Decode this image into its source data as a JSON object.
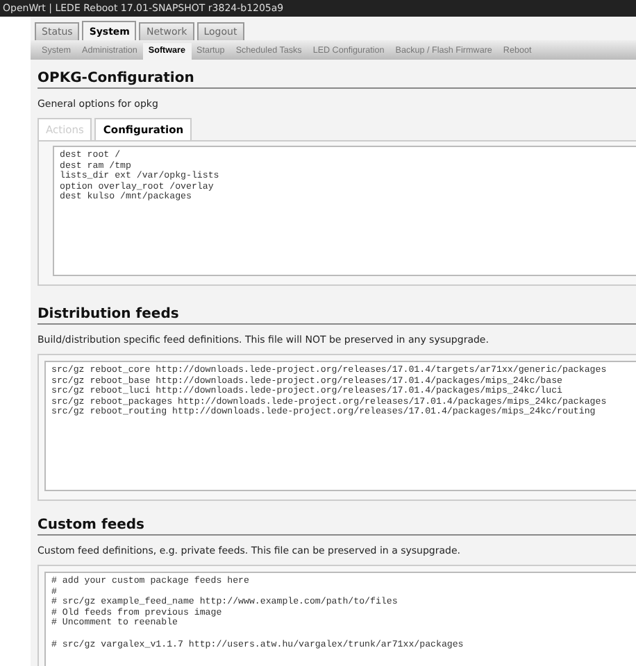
{
  "header": {
    "title": "OpenWrt | LEDE Reboot 17.01-SNAPSHOT r3824-b1205a9"
  },
  "main_tabs": [
    {
      "label": "Status",
      "selected": false
    },
    {
      "label": "System",
      "selected": true
    },
    {
      "label": "Network",
      "selected": false
    },
    {
      "label": "Logout",
      "selected": false
    }
  ],
  "sub_tabs": [
    {
      "label": "System",
      "selected": false
    },
    {
      "label": "Administration",
      "selected": false
    },
    {
      "label": "Software",
      "selected": true
    },
    {
      "label": "Startup",
      "selected": false
    },
    {
      "label": "Scheduled Tasks",
      "selected": false
    },
    {
      "label": "LED Configuration",
      "selected": false
    },
    {
      "label": "Backup / Flash Firmware",
      "selected": false
    },
    {
      "label": "Reboot",
      "selected": false
    }
  ],
  "sections": [
    {
      "title": "OPKG-Configuration",
      "description": "General options for opkg",
      "tabs": [
        {
          "label": "Actions",
          "selected": false,
          "disabled": true
        },
        {
          "label": "Configuration",
          "selected": true,
          "disabled": false
        }
      ],
      "editor": "dest root /\ndest ram /tmp\nlists_dir ext /var/opkg-lists\noption overlay_root /overlay\ndest kulso /mnt/packages"
    },
    {
      "title": "Distribution feeds",
      "description": "Build/distribution specific feed definitions. This file will NOT be preserved in any sysupgrade.",
      "editor": "src/gz reboot_core http://downloads.lede-project.org/releases/17.01.4/targets/ar71xx/generic/packages\nsrc/gz reboot_base http://downloads.lede-project.org/releases/17.01.4/packages/mips_24kc/base\nsrc/gz reboot_luci http://downloads.lede-project.org/releases/17.01.4/packages/mips_24kc/luci\nsrc/gz reboot_packages http://downloads.lede-project.org/releases/17.01.4/packages/mips_24kc/packages\nsrc/gz reboot_routing http://downloads.lede-project.org/releases/17.01.4/packages/mips_24kc/routing"
    },
    {
      "title": "Custom feeds",
      "description": "Custom feed definitions, e.g. private feeds. This file can be preserved in a sysupgrade.",
      "editor": "# add your custom package feeds here\n#\n# src/gz example_feed_name http://www.example.com/path/to/files\n# Old feeds from previous image\n# Uncomment to reenable\n\n# src/gz vargalex_v1.1.7 http://users.atw.hu/vargalex/trunk/ar71xx/packages"
    }
  ]
}
